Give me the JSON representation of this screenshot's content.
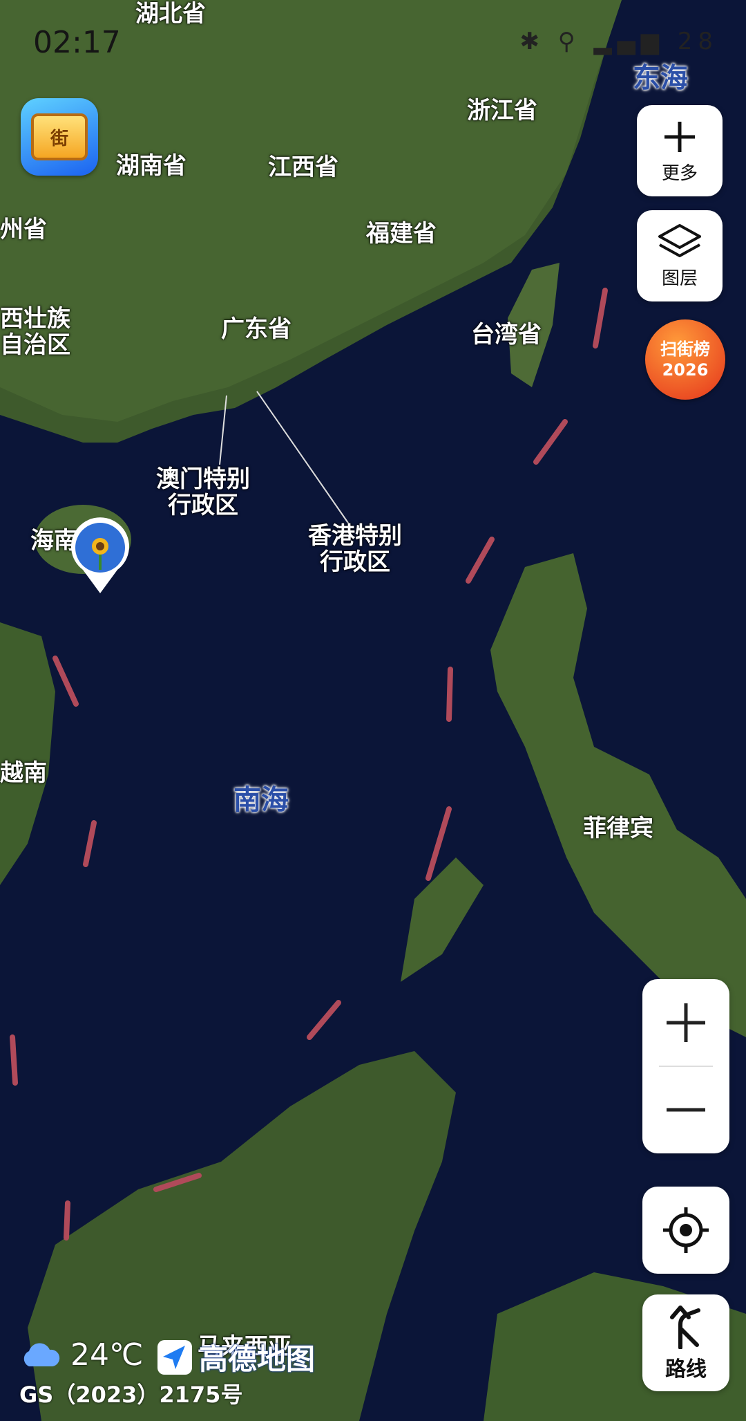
{
  "status_bar": {
    "time": "02:17",
    "battery": "28"
  },
  "map": {
    "sea_labels": {
      "east_sea": "东海",
      "south_sea": "南海"
    },
    "labels": {
      "hubei": "湖北省",
      "hunan": "湖南省",
      "jiangxi": "江西省",
      "zhejiang": "浙江省",
      "fujian": "福建省",
      "guizhou": "州省",
      "guangxi_line1": "西壮族",
      "guangxi_line2": "自治区",
      "guangdong": "广东省",
      "taiwan": "台湾省",
      "macau_line1": "澳门特别",
      "macau_line2": "行政区",
      "hongkong_line1": "香港特别",
      "hongkong_line2": "行政区",
      "hainan": "海南",
      "vietnam": "越南",
      "philippines": "菲律宾",
      "malaysia": "马来西亚"
    }
  },
  "toolbar": {
    "more_label": "更多",
    "layers_label": "图层",
    "badge_line1": "扫街榜",
    "badge_line2": "2026",
    "route_label": "路线"
  },
  "footer": {
    "temperature": "24℃",
    "brand": "高德地图",
    "license": "GS（2023）2175号"
  },
  "app_icon_glyph": "街",
  "colors": {
    "sea_label": "#2b4fa8",
    "badge": "#e4331b",
    "boundary_dash": "#b04a5a"
  }
}
